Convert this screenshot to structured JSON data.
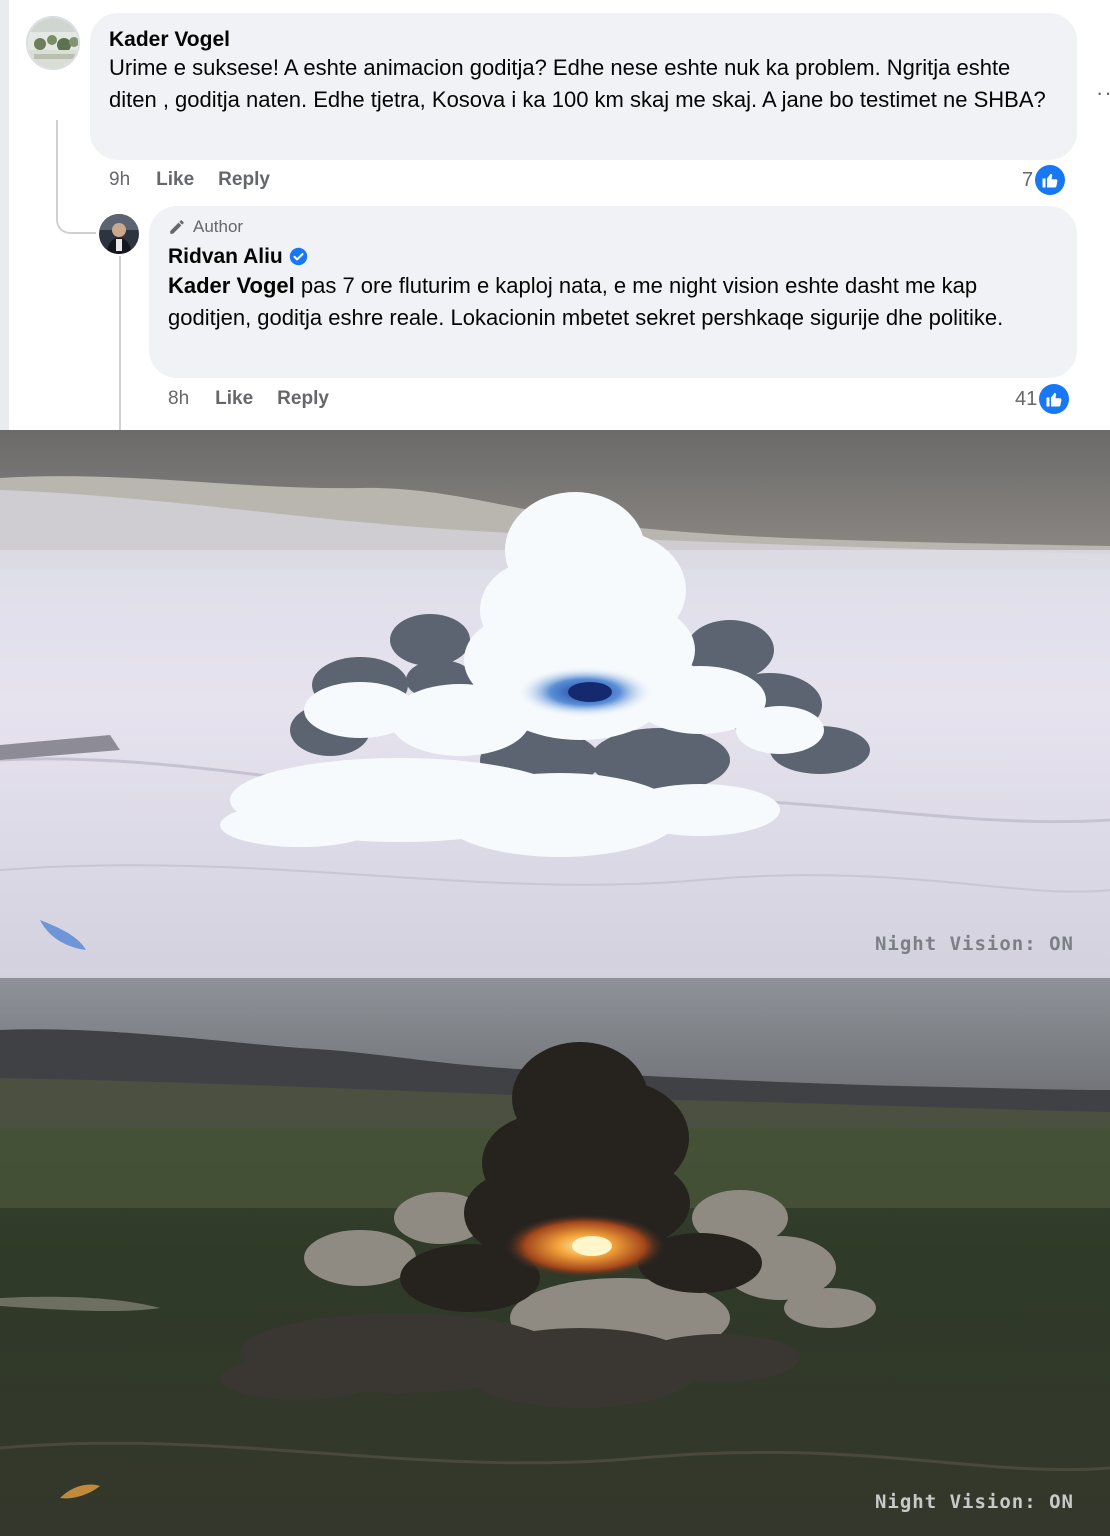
{
  "comment_1": {
    "author": "Kader Vogel",
    "text": "Urime e suksese! A eshte animacion goditja? Edhe nese eshte nuk ka problem. Ngritja eshte diten , goditja naten. Edhe tjetra, Kosova i ka 100 km skaj me skaj. A jane bo testimet ne SHBA?",
    "time": "9h",
    "like_label": "Like",
    "reply_label": "Reply",
    "reaction_count": "7",
    "reaction_icon": "thumbs-up-icon",
    "reaction_color": "#1877f2"
  },
  "reply_1": {
    "badge": "Author",
    "author": "Ridvan Aliu",
    "verified_icon": "verified-badge-icon",
    "mention": "Kader Vogel",
    "text": " pas 7 ore fluturim e kaploj nata, e me night vision eshte dasht me kap goditjen, goditja eshre reale. Lokacionin mbetet sekret pershkaqe sigurije dhe politike.",
    "time": "8h",
    "like_label": "Like",
    "reply_label": "Reply",
    "reaction_count": "41",
    "reaction_icon": "thumbs-up-icon"
  },
  "more_options_icon": "more-options-icon",
  "images": {
    "top": {
      "overlay": "Night Vision: ON",
      "overlay_color": "#7d7f86"
    },
    "bottom": {
      "overlay": "Night Vision: ON",
      "overlay_color": "#c9c9c9"
    }
  }
}
